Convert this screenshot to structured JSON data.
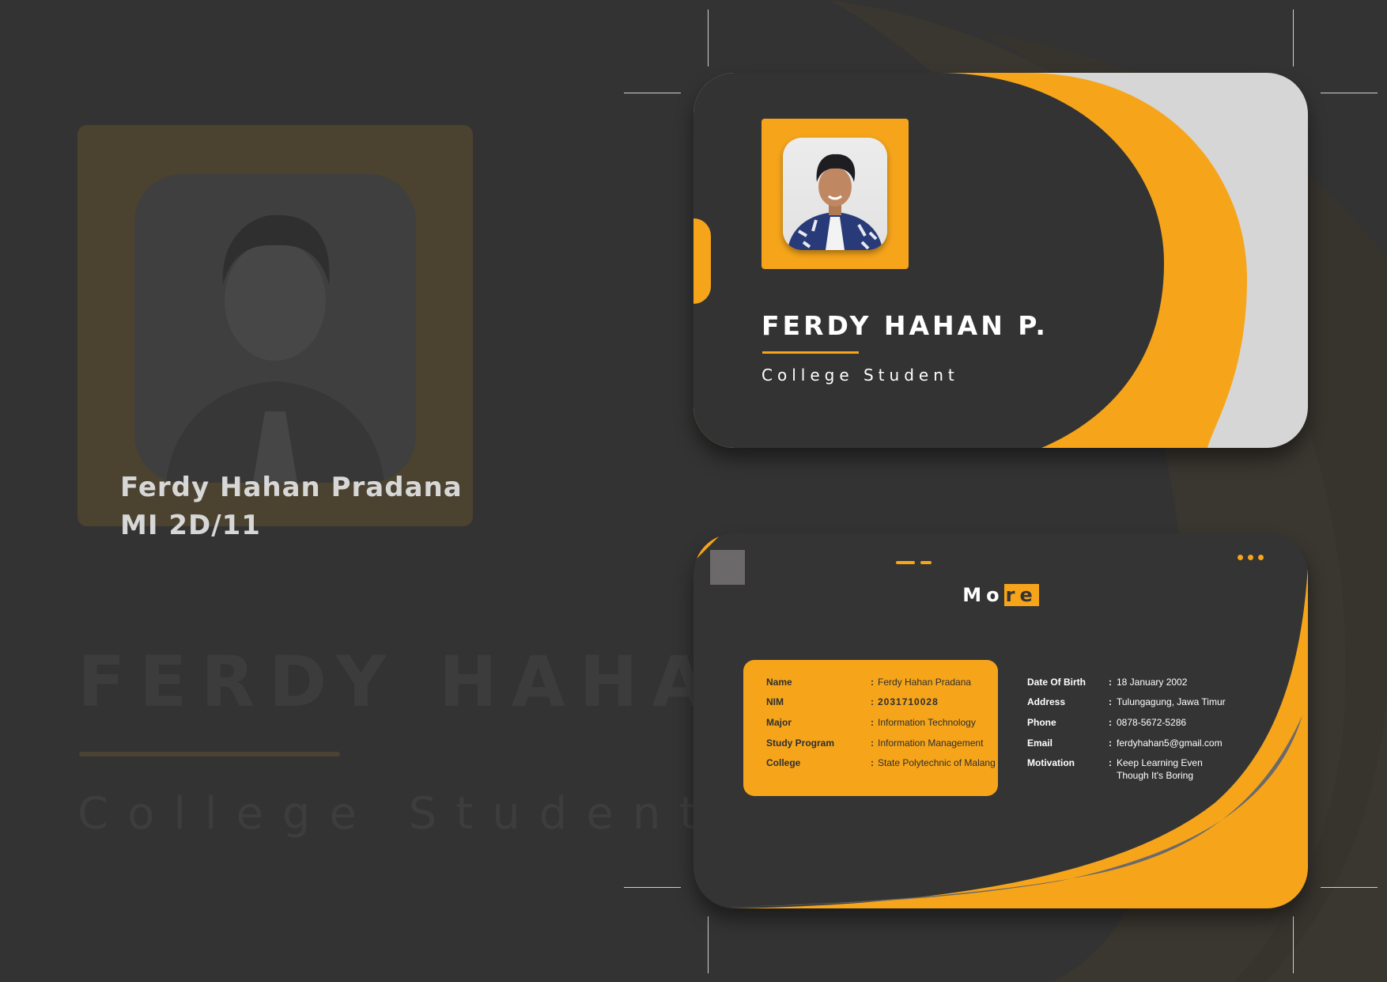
{
  "background": {
    "name_line1": "Ferdy Hahan Pradana",
    "name_line2": "MI 2D/11",
    "big_name": "FERDY HAHAN",
    "big_subtitle": "College Student"
  },
  "front_card": {
    "name": "FERDY HAHAN P.",
    "role": "College Student"
  },
  "back_card": {
    "title_part1": "Mo",
    "title_part2": "re",
    "left_fields": [
      {
        "label": "Name",
        "sep": ":",
        "value": "Ferdy Hahan Pradana"
      },
      {
        "label": "NIM",
        "sep": ":",
        "value": "2031710028"
      },
      {
        "label": "Major",
        "sep": ":",
        "value": "Information Technology"
      },
      {
        "label": "Study Program",
        "sep": ":",
        "value": "Information Management"
      },
      {
        "label": "College",
        "sep": ":",
        "value": "State Polytechnic of Malang"
      }
    ],
    "right_fields": [
      {
        "label": "Date Of Birth",
        "sep": ":",
        "value": "18 January 2002"
      },
      {
        "label": "Address",
        "sep": ":",
        "value": "Tulungagung, Jawa Timur"
      },
      {
        "label": "Phone",
        "sep": ":",
        "value": "0878-5672-5286"
      },
      {
        "label": "Email",
        "sep": ":",
        "value": "ferdyhahan5@gmail.com"
      },
      {
        "label": "Motivation",
        "sep": ":",
        "value": "Keep Learning Even Though It's Boring"
      }
    ]
  },
  "colors": {
    "accent": "#f6a51b",
    "card_dark": "#343434",
    "background": "#333333",
    "light_panel": "#d6d6d6"
  }
}
